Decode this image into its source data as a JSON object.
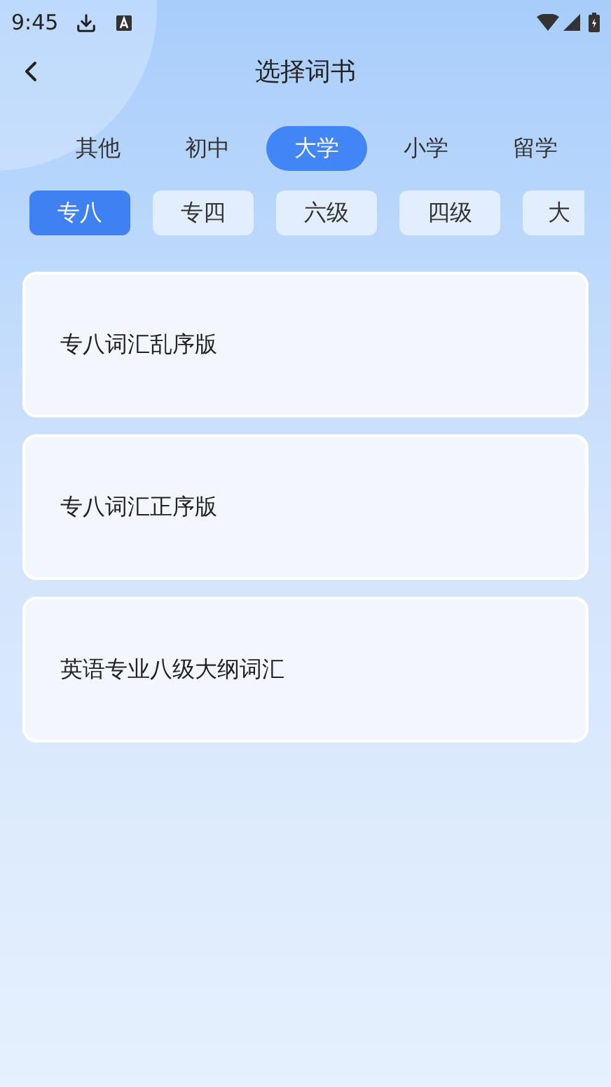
{
  "status_bar": {
    "time": "9:45"
  },
  "header": {
    "title": "选择词书"
  },
  "tabs": [
    {
      "label": "其他",
      "selected": false
    },
    {
      "label": "初中",
      "selected": false
    },
    {
      "label": "大学",
      "selected": true
    },
    {
      "label": "小学",
      "selected": false
    },
    {
      "label": "留学",
      "selected": false
    }
  ],
  "chips": [
    {
      "label": "专八",
      "selected": true
    },
    {
      "label": "专四",
      "selected": false
    },
    {
      "label": "六级",
      "selected": false
    },
    {
      "label": "四级",
      "selected": false
    },
    {
      "label": "大",
      "selected": false
    }
  ],
  "books": [
    {
      "title": "专八词汇乱序版"
    },
    {
      "title": "专八词汇正序版"
    },
    {
      "title": "英语专业八级大纲词汇"
    }
  ]
}
